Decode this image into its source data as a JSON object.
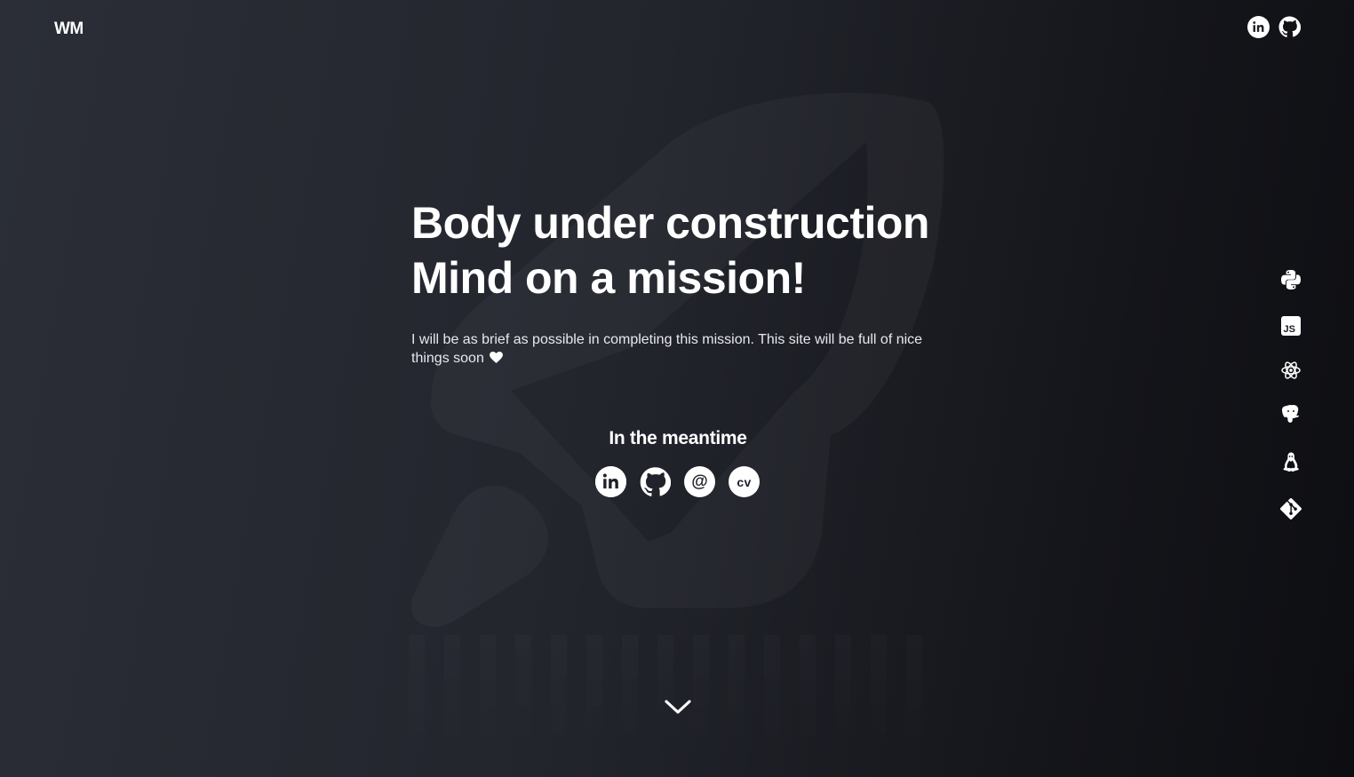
{
  "header": {
    "logo_text": "WM",
    "social_icons": [
      "linkedin-icon",
      "github-icon"
    ]
  },
  "hero": {
    "title_line1": "Body under construction",
    "title_line2": "Mind on a mission!",
    "description": "I will be as brief as possible in completing this mission. This site will be full of nice things soon",
    "description_icon": "heart-icon"
  },
  "meantime": {
    "heading": "In the meantime",
    "links": [
      {
        "icon": "linkedin-icon"
      },
      {
        "icon": "github-icon"
      },
      {
        "icon": "at-sign-icon",
        "label": "@"
      },
      {
        "icon": "cv-icon",
        "label": "CV"
      }
    ]
  },
  "tech_stack": [
    "python-icon",
    "javascript-icon",
    "react-icon",
    "postgresql-icon",
    "linux-icon",
    "git-icon"
  ],
  "scroll_icon": "chevron-down-icon",
  "colors": {
    "background_left": "#2b2e37",
    "background_right": "#0d0e12",
    "text": "#ffffff",
    "rocket_watermark": "#2f313b"
  }
}
